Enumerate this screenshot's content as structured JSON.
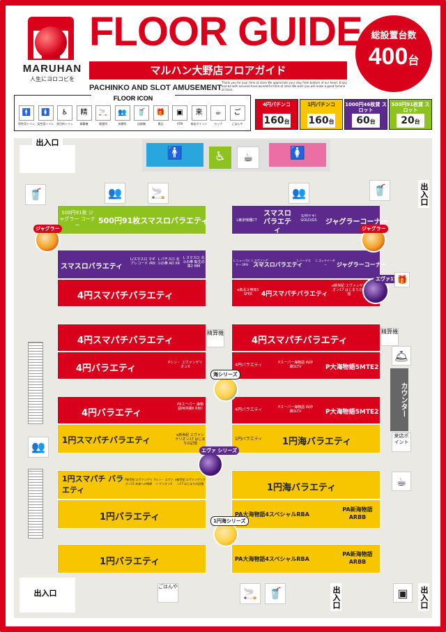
{
  "brand": {
    "name": "MARUHAN",
    "slogan": "人生にヨロコビを"
  },
  "header": {
    "title": "FLOOR GUIDE",
    "subtitle": "マルハン大野店フロアガイド",
    "tagline": "PACHINKO AND SLOT AMUSEMENT",
    "note": "Thank you for your time at store We appreciate your stay from bottom of our heart. Enjoy and be with assured have wonderful time at store We wish you will make a good fortune at store."
  },
  "total": {
    "label": "総設置台数",
    "value": "400",
    "unit": "台"
  },
  "icon_legend": {
    "title": "FLOOR ICON",
    "items": [
      {
        "icon": "man-icon",
        "glyph": "🚹",
        "label": "男性用トイレ"
      },
      {
        "icon": "woman-icon",
        "glyph": "🚺",
        "label": "女性用トイレ"
      },
      {
        "icon": "wheelchair-icon",
        "glyph": "♿",
        "label": "多目的トイレ"
      },
      {
        "icon": "pay-machine-icon",
        "glyph": "精",
        "label": "精算機"
      },
      {
        "icon": "smoking-icon",
        "glyph": "🚬",
        "label": "喫煙所"
      },
      {
        "icon": "rest-icon",
        "glyph": "👥",
        "label": "休憩所"
      },
      {
        "icon": "drink-icon",
        "glyph": "🥤",
        "label": "自販機"
      },
      {
        "icon": "gift-icon",
        "glyph": "🎁",
        "label": "景品"
      },
      {
        "icon": "atm-icon",
        "glyph": "▣",
        "label": "ATM"
      },
      {
        "icon": "visit-point-icon",
        "glyph": "来",
        "label": "来店ポイント"
      },
      {
        "icon": "cup-icon",
        "glyph": "☕",
        "label": "カップ"
      },
      {
        "icon": "gohanya-icon",
        "glyph": "ご",
        "label": "ごはんや"
      }
    ]
  },
  "categories": [
    {
      "name": "4円パチンコ",
      "count": "160",
      "unit": "台",
      "color": "#d9001b"
    },
    {
      "name": "1円パチンコ",
      "count": "160",
      "unit": "台",
      "color": "#f7c600"
    },
    {
      "name": "1000円46枚貸 スロット",
      "count": "60",
      "unit": "台",
      "color": "#5b2a8c"
    },
    {
      "name": "500円91枚貸 スロット",
      "count": "20",
      "unit": "台",
      "color": "#8dc21f"
    }
  ],
  "floor": {
    "exit": "出入口",
    "counter": "カウンター",
    "visit_point": "来店ポイント",
    "pay_machine": "精算機",
    "gohanya": "ごはんや",
    "blocks": {
      "g500_small": "500円91枚 ジャグラー コーナー",
      "g500_main": "500円91枚スマスロバラエティ",
      "p_top_right_small1": "L東京喰種CT",
      "p_top_right_main": "スマスロ バラエティ",
      "p_top_right_small2": "S/沖ドキ! GOLD/GS",
      "p_top_right_juggler": "ジャグラーコーナー",
      "p_left_main": "スマスロバラエティ",
      "p_left_s1": "L/スマスロ マギアレコード /RN",
      "p_left_s2": "L パチスロ 北斗の拳 AD XR",
      "p_left_s3": "L スマスロ 北斗の拳 転生の章2 MM",
      "p_right_s1": "L ニューパルサー SPIII",
      "p_right_s2": "L ヱヴァンゲリオン",
      "p_right_main": "スマスロバラエティ",
      "p_right_s3": "L ハーデス",
      "p_right_s4": "L ゴッドイーター",
      "p_right_juggler": "ジャグラーコーナー",
      "r4_smapachi_1": "4円スマパチバラエティ",
      "r4_right1_small": "e真北斗無双5 SFEE",
      "r4_right1_main": "4円スマパチバラエティ",
      "r4_right1_small2": "e新世紀 エヴァンゲリオン17 はじまりの記憶",
      "r4_smapachi_2": "4円スマパチバラエティ",
      "r4_smapachi_3": "4円スマパチバラエティ",
      "r4_variety_1": "4円バラエティ",
      "r4_variety_1_small": "Pシン・ エヴァンゲリオンX",
      "r4_variety_r_small": "4円バラエティ",
      "r4_variety_r_small2": "Pスーパー海物語 IN沖縄5LTV",
      "r4_variety_r_main": "P大海物語5MTE2",
      "r4_variety_2": "4円バラエティ",
      "r4_variety_2_small": "PAスーパー 海物語IN沖縄6 RBD",
      "r4_variety_r2_small": "4円バラエティ",
      "r4_variety_r2_small2": "Pスーパー海物語 IN沖縄5LTV",
      "r4_variety_r2_main": "P大海物語5MTE2",
      "y1_smapachi": "1円スマパチバラエティ",
      "y1_smapachi_small": "e新世紀 エヴァンゲリオン17 はじまりの記憶",
      "y1_umi_small": "1円バラエティ",
      "y1_umi_main": "1円海バラエティ",
      "y1_smapachi2": "1円スマパチ バラエティ",
      "y1_s2a": "P新世紀 エヴァンゲリオン15 未来への咆哮",
      "y1_s2b": "Pシン・ エヴァン ゲリオンX",
      "y1_s2c": "e新世紀 エヴァンゲリオン17 はじまりの記憶",
      "y1_umi2": "1円海バラエティ",
      "y1_variety1": "1円バラエティ",
      "y1_pa1": "PA大海物語4スペシャルRBA",
      "y1_pa1b": "PA新海物語 ARBB",
      "y1_variety2": "1円バラエティ",
      "y1_pa2": "PA大海物語4スペシャルRBA",
      "y1_pa2b": "PA新海物語 ARBB"
    },
    "characters": {
      "juggler": "ジャグラー",
      "eva17": "エヴァ17",
      "umi_series": "海シリーズ",
      "eva_series": "エヴァ シリーズ",
      "umi1": "1円海シリーズ"
    }
  }
}
